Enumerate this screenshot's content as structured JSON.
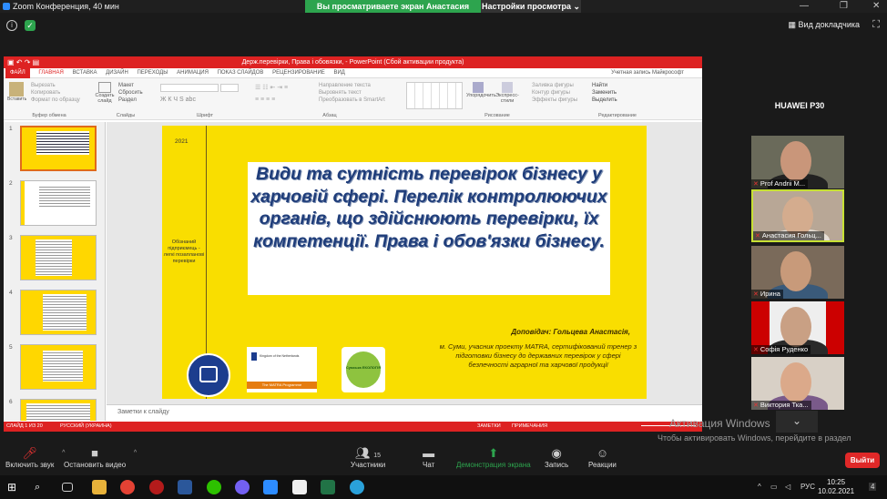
{
  "zoom": {
    "window_title": "Zoom Конференция, 40 мин",
    "share_banner": "Вы просматриваете экран Анастасия Гольцева",
    "view_options": "Настройки просмотра ⌄",
    "speaker_view": "Вид докладчика",
    "gallery_title": "HUAWEI P30",
    "participants": [
      {
        "name": "Prof Andrii M...",
        "muted": true,
        "active": false
      },
      {
        "name": "Анастасия Гольц...",
        "muted": true,
        "active": true
      },
      {
        "name": "Ирина",
        "muted": true,
        "active": false
      },
      {
        "name": "Софія Руденко",
        "muted": true,
        "active": false
      },
      {
        "name": "Виктория Тка...",
        "muted": true,
        "active": false
      }
    ],
    "toolbar": {
      "unmute": "Включить звук",
      "video": "Остановить видео",
      "participants": "Участники",
      "participants_count": "15",
      "chat": "Чат",
      "share": "Демонстрация экрана",
      "record": "Запись",
      "reactions": "Реакции",
      "leave": "Выйти"
    }
  },
  "ppt": {
    "title": "Держ.перевірки, Права і обовязки, - PowerPoint (Сбой активации продукта)",
    "tabs": [
      "ФАЙЛ",
      "ГЛАВНАЯ",
      "ВСТАВКА",
      "ДИЗАЙН",
      "ПЕРЕХОДЫ",
      "АНИМАЦИЯ",
      "ПОКАЗ СЛАЙДОВ",
      "РЕЦЕНЗИРОВАНИЕ",
      "ВИД"
    ],
    "account": "Учетная запись Майкрософт",
    "ribbon": {
      "clipboard": {
        "cut": "Вырезать",
        "copy": "Копировать",
        "format": "Формат по образцу",
        "paste": "Вставить",
        "label": "Буфер обмена"
      },
      "slides": {
        "create": "Создать слайд",
        "layout": "Макет",
        "reset": "Сбросить",
        "section": "Раздел",
        "label": "Слайды"
      },
      "font": {
        "label": "Шрифт"
      },
      "paragraph": {
        "dir": "Направление текста",
        "align": "Выровнять текст",
        "smartart": "Преобразовать в SmartArt",
        "label": "Абзац"
      },
      "drawing": {
        "arrange": "Упорядочить",
        "styles": "Экспресс-стили",
        "fill": "Заливка фигуры",
        "outline": "Контур фигуры",
        "effects": "Эффекты фигуры",
        "label": "Рисование"
      },
      "editing": {
        "find": "Найти",
        "replace": "Заменить",
        "select": "Выделить",
        "label": "Редактирование"
      }
    },
    "slide_numbers": [
      "1",
      "2",
      "3",
      "4",
      "5",
      "6"
    ],
    "slide": {
      "year": "2021",
      "side_text": "Обізнаний підприємець - легкі позапланові перевірки",
      "title": "Види та сутність перевірок бізнесу у харчовій сфері. Перелік контролюючих органів, що здійснюють перевірки, їх компетенції. Права і обов'язки бізнесу.",
      "presenter": "Доповідач: Гольцева Анастасія,",
      "description": "м. Суми, учасник проекту MATRA, сертифікований тренер з підготовки бізнесу до державних перевірок у сфері безпечності аграрної та харчової продукції",
      "logo2_caption": "Kingdom of the Netherlands",
      "logo2_bar": "The MATRA Programme",
      "logo3_text": "Сумська ЕКОЛОГІЯ"
    },
    "notes_placeholder": "Заметки к слайду",
    "status": {
      "slide": "СЛАЙД 1 ИЗ 20",
      "lang": "РУССКИЙ (УКРАИНА)",
      "notes": "ЗАМЕТКИ",
      "comments": "ПРИМЕЧАНИЯ"
    }
  },
  "windows": {
    "activate_title": "Активация Windows",
    "activate_text": "Чтобы активировать Windows, перейдите в раздел \"Параметры\".",
    "lang": "РУС",
    "time": "10:25",
    "date": "10.02.2021",
    "notif": "4"
  }
}
